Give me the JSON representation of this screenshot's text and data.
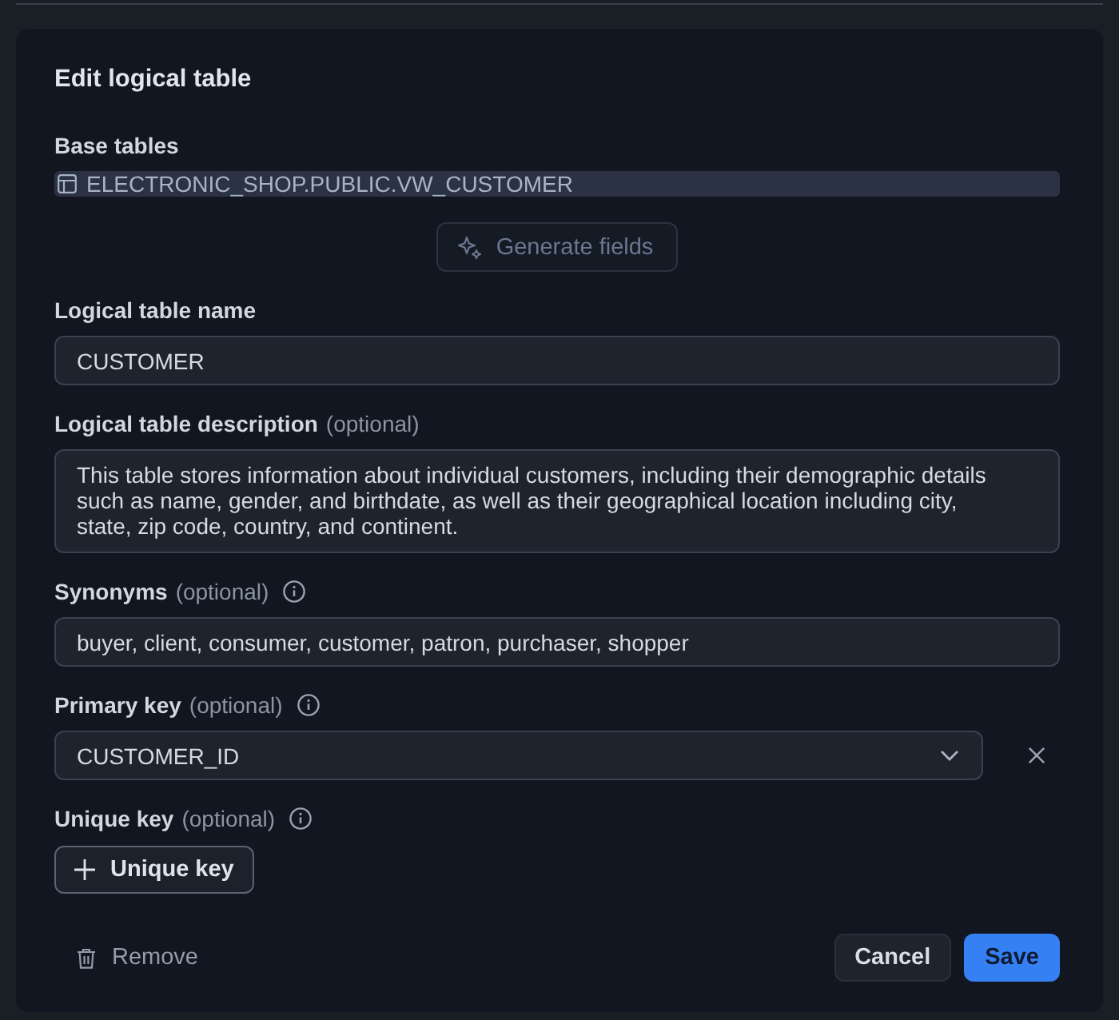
{
  "dialog": {
    "title": "Edit logical table"
  },
  "base_tables": {
    "label": "Base tables",
    "items": [
      {
        "name": "ELECTRONIC_SHOP.PUBLIC.VW_CUSTOMER"
      }
    ]
  },
  "generate_button": {
    "label": "Generate fields",
    "disabled": true
  },
  "fields": [
    {
      "kind": "input",
      "label": "Logical table name",
      "info": false,
      "value": "CUSTOMER"
    },
    {
      "kind": "textarea",
      "label": "Logical table description",
      "hint": "(optional)",
      "info": false,
      "value": "This table stores information about individual customers, including their demographic details such as name, gender, and birthdate, as well as their geographical location including city, state, zip code, country, and continent."
    },
    {
      "kind": "input",
      "label": "Synonyms",
      "hint": "(optional)",
      "info": true,
      "value": "buyer, client, consumer, customer, patron, purchaser, shopper"
    },
    {
      "kind": "select",
      "label": "Primary key",
      "hint": "(optional)",
      "info": true,
      "value": "CUSTOMER_ID",
      "clearable": true
    },
    {
      "kind": "add",
      "label": "Unique key",
      "hint": "(optional)",
      "info": true,
      "button": "Unique key"
    }
  ],
  "footer": {
    "remove": "Remove",
    "actions": [
      {
        "label": "Cancel",
        "kind": "secondary"
      },
      {
        "label": "Save",
        "kind": "primary"
      }
    ]
  }
}
